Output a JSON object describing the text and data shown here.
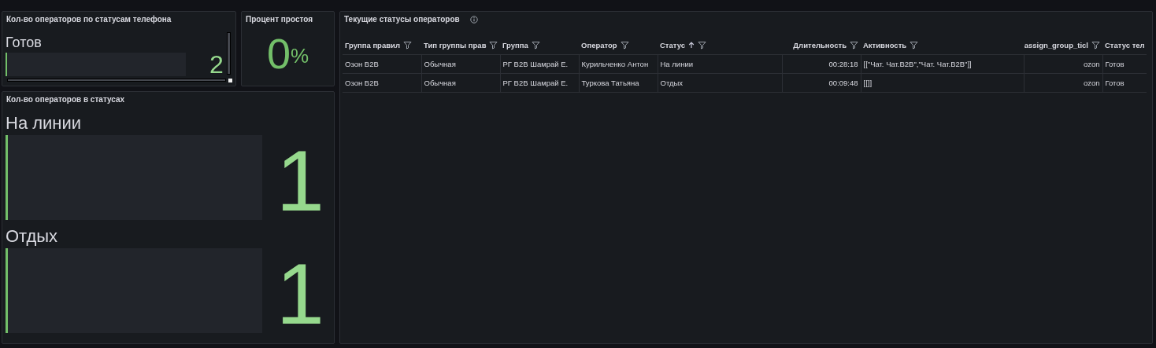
{
  "panels": {
    "phone_status": {
      "title": "Кол-во операторов по статусам телефона",
      "bars": [
        {
          "label": "Готов",
          "value": "2",
          "level": 0.01
        }
      ]
    },
    "idle": {
      "title": "Процент простоя",
      "value": "0",
      "unit": "%"
    },
    "statuses": {
      "title": "Кол-во операторов в статусах",
      "bars": [
        {
          "label": "На линии",
          "value": "1",
          "level": 0.01
        },
        {
          "label": "Отдых",
          "value": "1",
          "level": 0.01
        }
      ]
    },
    "table": {
      "title": "Текущие статусы операторов",
      "columns": [
        {
          "label": "Группа правил",
          "filter": true,
          "sorted": false,
          "kind": "text"
        },
        {
          "label": "Тип группы прав",
          "filter": true,
          "sorted": false,
          "kind": "text"
        },
        {
          "label": "Группа",
          "filter": true,
          "sorted": false,
          "kind": "text"
        },
        {
          "label": "Оператор",
          "filter": true,
          "sorted": false,
          "kind": "text"
        },
        {
          "label": "Статус",
          "filter": true,
          "sorted": true,
          "kind": "text"
        },
        {
          "label": "Длительность",
          "filter": true,
          "sorted": false,
          "kind": "number"
        },
        {
          "label": "Активность",
          "filter": true,
          "sorted": false,
          "kind": "text"
        },
        {
          "label": "assign_group_ticl",
          "filter": true,
          "sorted": false,
          "kind": "number"
        },
        {
          "label": "Статус тел",
          "filter": false,
          "sorted": false,
          "kind": "text"
        }
      ],
      "rows": [
        [
          "Озон B2B",
          "Обычная",
          "РГ B2B Шамрай Е.",
          "Курильченко Антон",
          "На линии",
          "00:28:18",
          "[[\"Чат. Чат.B2B\",\"Чат. Чат.B2B\"]]",
          "ozon",
          "Готов"
        ],
        [
          "Озон B2B",
          "Обычная",
          "РГ B2B Шамрай Е.",
          "Туркова Татьяна",
          "Отдых",
          "00:09:48",
          "[[]]",
          "ozon",
          "Готов"
        ]
      ]
    }
  }
}
